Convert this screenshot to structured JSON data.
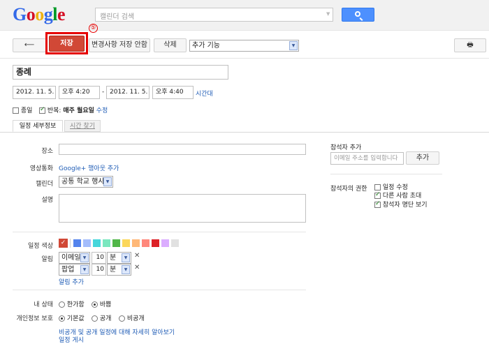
{
  "header": {
    "search_placeholder": "캘린더 검색"
  },
  "toolbar": {
    "save_label": "저장",
    "discard_label": "변경사항 저장 안함",
    "delete_label": "삭제",
    "more_actions": "추가 기능",
    "annotation": "⑤"
  },
  "event": {
    "title": "종례",
    "start_date": "2012. 11. 5.",
    "start_time": "오후 4:20",
    "dash": "-",
    "end_date": "2012. 11. 5.",
    "end_time": "오후 4:40",
    "timezone_link": "시간대",
    "all_day_label": "종일",
    "repeat_label": "반복:",
    "repeat_value": "매주 월요일",
    "repeat_edit": "수정"
  },
  "tabs": {
    "details": "일정 세부정보",
    "find_time": "시간 찾기"
  },
  "details": {
    "where_label": "장소",
    "video_label": "영상통화",
    "video_link": "Google+ 행아웃 추가",
    "calendar_label": "캘린더",
    "calendar_value": "공통 학교 행사",
    "description_label": "설명",
    "color_label": "일정 색상",
    "reminder_label": "알림",
    "reminders": [
      {
        "method": "이메일",
        "amount": "10",
        "unit": "분"
      },
      {
        "method": "팝업",
        "amount": "10",
        "unit": "분"
      }
    ],
    "add_reminder": "알림 추가",
    "show_me_as_label": "내 상태",
    "available": "한가함",
    "busy": "바쁨",
    "privacy_label": "개인정보 보호",
    "privacy_default": "기본값",
    "privacy_public": "공개",
    "privacy_private": "비공개",
    "privacy_learn_more": "비공개 및 공개 일정에 대해 자세히 알아보기",
    "publish_event": "일정 게시"
  },
  "guests": {
    "title": "참석자 추가",
    "input_placeholder": "이메일 주소를 입력합니다",
    "add_button": "추가",
    "permissions_label": "참석자의 권한",
    "perm_modify": "일정 수정",
    "perm_invite": "다른 사람 초대",
    "perm_see_list": "참석자 명단 보기"
  },
  "colors": {
    "selected": "#d14836",
    "swatches": [
      "#5484ed",
      "#a4bdfc",
      "#46d6db",
      "#7ae7bf",
      "#51b749",
      "#fbd75b",
      "#ffb878",
      "#ff887c",
      "#dc2127",
      "#dbadff",
      "#e1e1e1"
    ]
  }
}
